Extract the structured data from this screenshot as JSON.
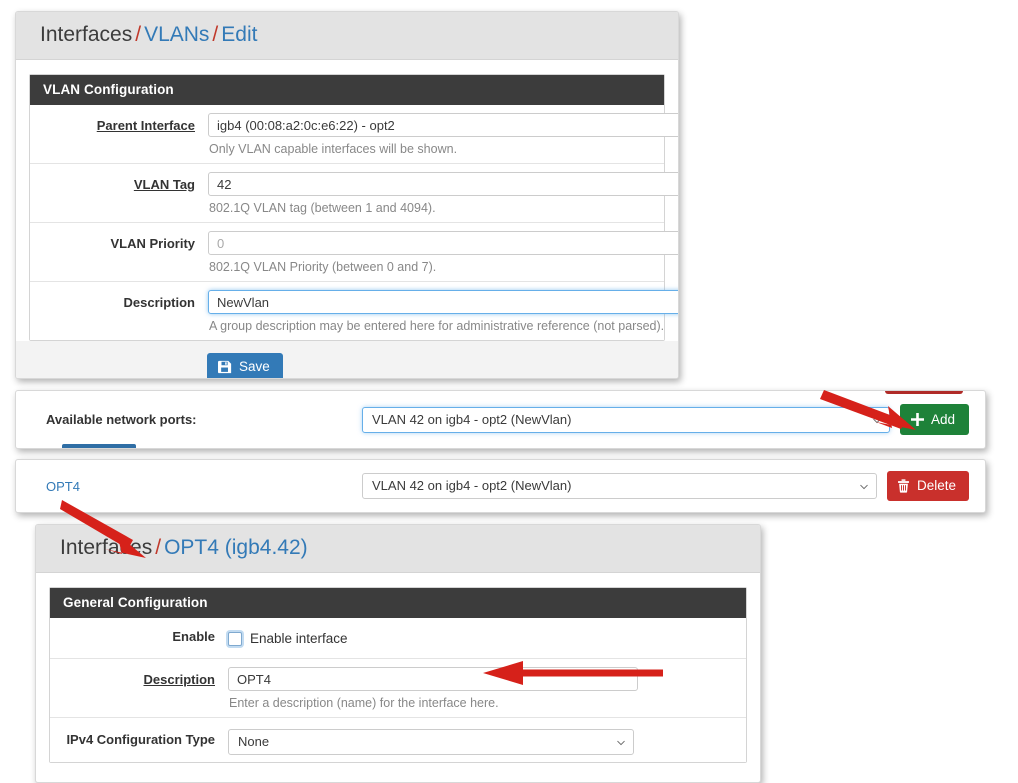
{
  "vlan_edit": {
    "breadcrumb": {
      "root": "Interfaces",
      "sep": "/",
      "section": "VLANs",
      "action": "Edit"
    },
    "panel_title": "VLAN Configuration",
    "fields": [
      {
        "label": "Parent Interface",
        "value": "igb4 (00:08:a2:0c:e6:22) - opt2",
        "help": "Only VLAN capable interfaces will be shown."
      },
      {
        "label": "VLAN Tag",
        "value": "42",
        "help": "802.1Q VLAN tag (between 1 and 4094)."
      },
      {
        "label": "VLAN Priority",
        "value": "0",
        "help": "802.1Q VLAN Priority (between 0 and 7)."
      },
      {
        "label": "Description",
        "value": "NewVlan",
        "help": "A group description may be entered here for administrative reference (not parsed)."
      }
    ],
    "save_label": "Save",
    "save_icon": "floppy-disk-icon"
  },
  "assign_add": {
    "label": "Available network ports:",
    "selected_port": "VLAN 42 on igb4 - opt2 (NewVlan)",
    "add_label": "Add",
    "add_icon": "plus-icon"
  },
  "assign_row": {
    "interface_link": "OPT4",
    "selected_port": "VLAN 42 on igb4 - opt2 (NewVlan)",
    "delete_label": "Delete",
    "delete_icon": "trash-icon"
  },
  "opt4_page": {
    "breadcrumb": {
      "root": "Interfaces",
      "sep": "/",
      "current": "OPT4 (igb4.42)"
    },
    "panel_title": "General Configuration",
    "enable": {
      "label": "Enable",
      "checkbox_text": "Enable interface",
      "checked": false
    },
    "description": {
      "label": "Description",
      "value": "OPT4",
      "help": "Enter a description (name) for the interface here."
    },
    "ipv4": {
      "label": "IPv4 Configuration Type",
      "value": "None"
    }
  },
  "colors": {
    "accent_blue": "#337ab7",
    "panel_header": "#3c3c3c",
    "crumb_bar": "#e3e3e3",
    "add_green": "#1e8239",
    "delete_red": "#c9302c",
    "annotation_red": "#d6211a",
    "focus_blue": "#66afe9"
  },
  "annotations": [
    {
      "name": "arrow-to-add-button",
      "direction": "down-right"
    },
    {
      "name": "arrow-to-interfaces-breadcrumb",
      "direction": "down-right"
    },
    {
      "name": "arrow-to-description-field",
      "direction": "left"
    }
  ]
}
